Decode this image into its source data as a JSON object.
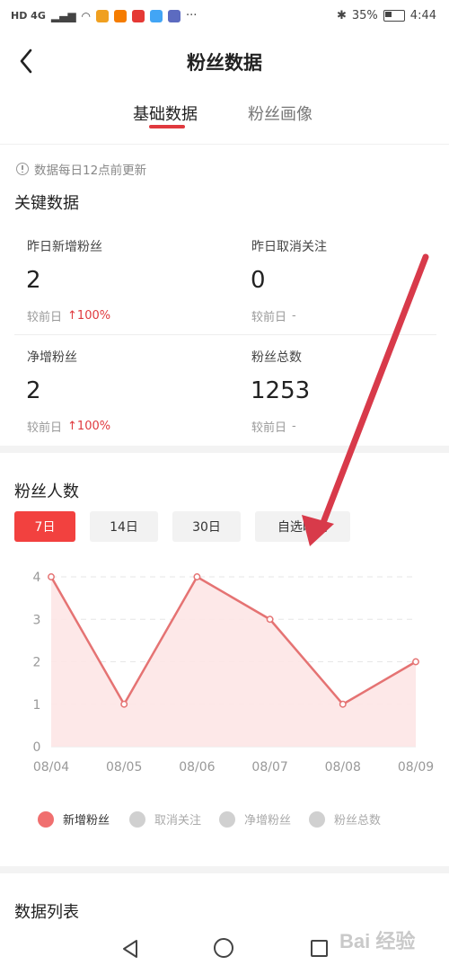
{
  "status_bar": {
    "left_text": "HD 4G",
    "right_battery": "35%",
    "time": "4:44",
    "more": "···"
  },
  "header": {
    "title": "粉丝数据",
    "tabs": [
      {
        "label": "基础数据",
        "active": true
      },
      {
        "label": "粉丝画像",
        "active": false
      }
    ]
  },
  "notice": "数据每日12点前更新",
  "key_data": {
    "title": "关键数据",
    "stats": [
      {
        "label": "昨日新增粉丝",
        "value": "2",
        "cmp_label": "较前日",
        "cmp_value": "100%",
        "trend": "up"
      },
      {
        "label": "昨日取消关注",
        "value": "0",
        "cmp_label": "较前日",
        "cmp_value": "-",
        "trend": "none"
      },
      {
        "label": "净增粉丝",
        "value": "2",
        "cmp_label": "较前日",
        "cmp_value": "100%",
        "trend": "up"
      },
      {
        "label": "粉丝总数",
        "value": "1253",
        "cmp_label": "较前日",
        "cmp_value": "-",
        "trend": "none"
      }
    ],
    "up_arrow": "↑"
  },
  "fans_count": {
    "title": "粉丝人数",
    "ranges": [
      {
        "label": "7日",
        "active": true
      },
      {
        "label": "14日",
        "active": false
      },
      {
        "label": "30日",
        "active": false
      },
      {
        "label": "自选时间",
        "active": false
      }
    ]
  },
  "chart_data": {
    "type": "area",
    "x": [
      "08/04",
      "08/05",
      "08/06",
      "08/07",
      "08/08",
      "08/09"
    ],
    "series": [
      {
        "name": "新增粉丝",
        "values": [
          4,
          1,
          4,
          3,
          1,
          2
        ]
      }
    ],
    "y_ticks": [
      "0",
      "1",
      "2",
      "3",
      "4"
    ],
    "ylim": [
      0,
      4
    ],
    "grid": true,
    "colors": {
      "line": "#e57373",
      "fill": "#fde6e6",
      "grid": "#e6e6e6"
    }
  },
  "legend": [
    {
      "label": "新增粉丝",
      "color": "#f06f6f",
      "active": true
    },
    {
      "label": "取消关注",
      "color": "#d0d0d0",
      "active": false
    },
    {
      "label": "净增粉丝",
      "color": "#d0d0d0",
      "active": false
    },
    {
      "label": "粉丝总数",
      "color": "#d0d0d0",
      "active": false
    }
  ],
  "data_list": {
    "title": "数据列表"
  },
  "watermark": "Bai 经验",
  "colors": {
    "accent": "#f2413f",
    "arrow": "#d83a4a"
  }
}
